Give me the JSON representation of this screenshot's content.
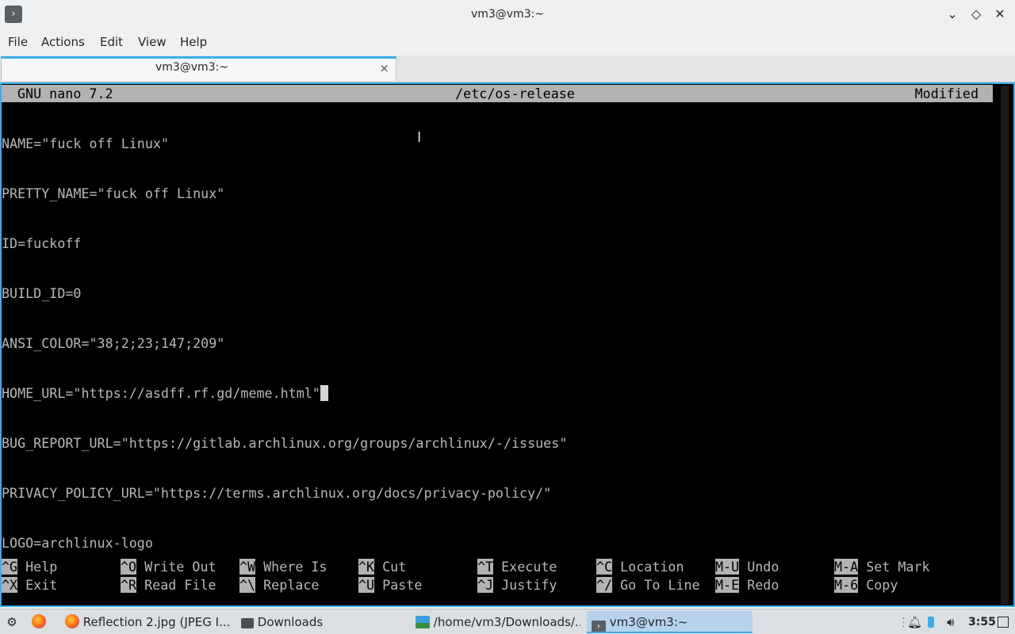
{
  "window": {
    "title": "vm3@vm3:~",
    "app_icon": "terminal-icon"
  },
  "menu": [
    "File",
    "Actions",
    "Edit",
    "View",
    "Help"
  ],
  "tab": {
    "label": "vm3@vm3:~",
    "close": "×"
  },
  "nano": {
    "version": "GNU nano 7.2",
    "filename": "/etc/os-release",
    "status": "Modified",
    "lines": [
      "NAME=\"fuck off Linux\"",
      "PRETTY_NAME=\"fuck off Linux\"",
      "ID=fuckoff",
      "BUILD_ID=0",
      "ANSI_COLOR=\"38;2;23;147;209\"",
      "HOME_URL=\"https://asdff.rf.gd/meme.html\"",
      "BUG_REPORT_URL=\"https://gitlab.archlinux.org/groups/archlinux/-/issues\"",
      "PRIVACY_POLICY_URL=\"https://terms.archlinux.org/docs/privacy-policy/\"",
      "LOGO=archlinux-logo"
    ],
    "shortcuts_row1": [
      {
        "key": "^G",
        "label": "Help"
      },
      {
        "key": "^O",
        "label": "Write Out"
      },
      {
        "key": "^W",
        "label": "Where Is"
      },
      {
        "key": "^K",
        "label": "Cut"
      },
      {
        "key": "^T",
        "label": "Execute"
      },
      {
        "key": "^C",
        "label": "Location"
      },
      {
        "key": "M-U",
        "label": "Undo"
      },
      {
        "key": "M-A",
        "label": "Set Mark"
      }
    ],
    "shortcuts_row2": [
      {
        "key": "^X",
        "label": "Exit"
      },
      {
        "key": "^R",
        "label": "Read File"
      },
      {
        "key": "^\\",
        "label": "Replace"
      },
      {
        "key": "^U",
        "label": "Paste"
      },
      {
        "key": "^J",
        "label": "Justify"
      },
      {
        "key": "^/",
        "label": "Go To Line"
      },
      {
        "key": "M-E",
        "label": "Redo"
      },
      {
        "key": "M-6",
        "label": "Copy"
      }
    ]
  },
  "taskbar": {
    "tasks": [
      {
        "label": "Reflection 2.jpg (JPEG I...",
        "icon": "firefox-icon"
      },
      {
        "label": "Downloads",
        "icon": "folder-icon"
      },
      {
        "label": "/home/vm3/Downloads/...",
        "icon": "image-viewer-icon"
      },
      {
        "label": "vm3@vm3:~",
        "icon": "terminal-icon"
      }
    ],
    "clock": "3:55"
  },
  "colors": {
    "accent": "#3daee9",
    "terminal_bg": "#000000",
    "terminal_fg": "#b8b8b8",
    "nano_bar": "#b2b2b2"
  }
}
